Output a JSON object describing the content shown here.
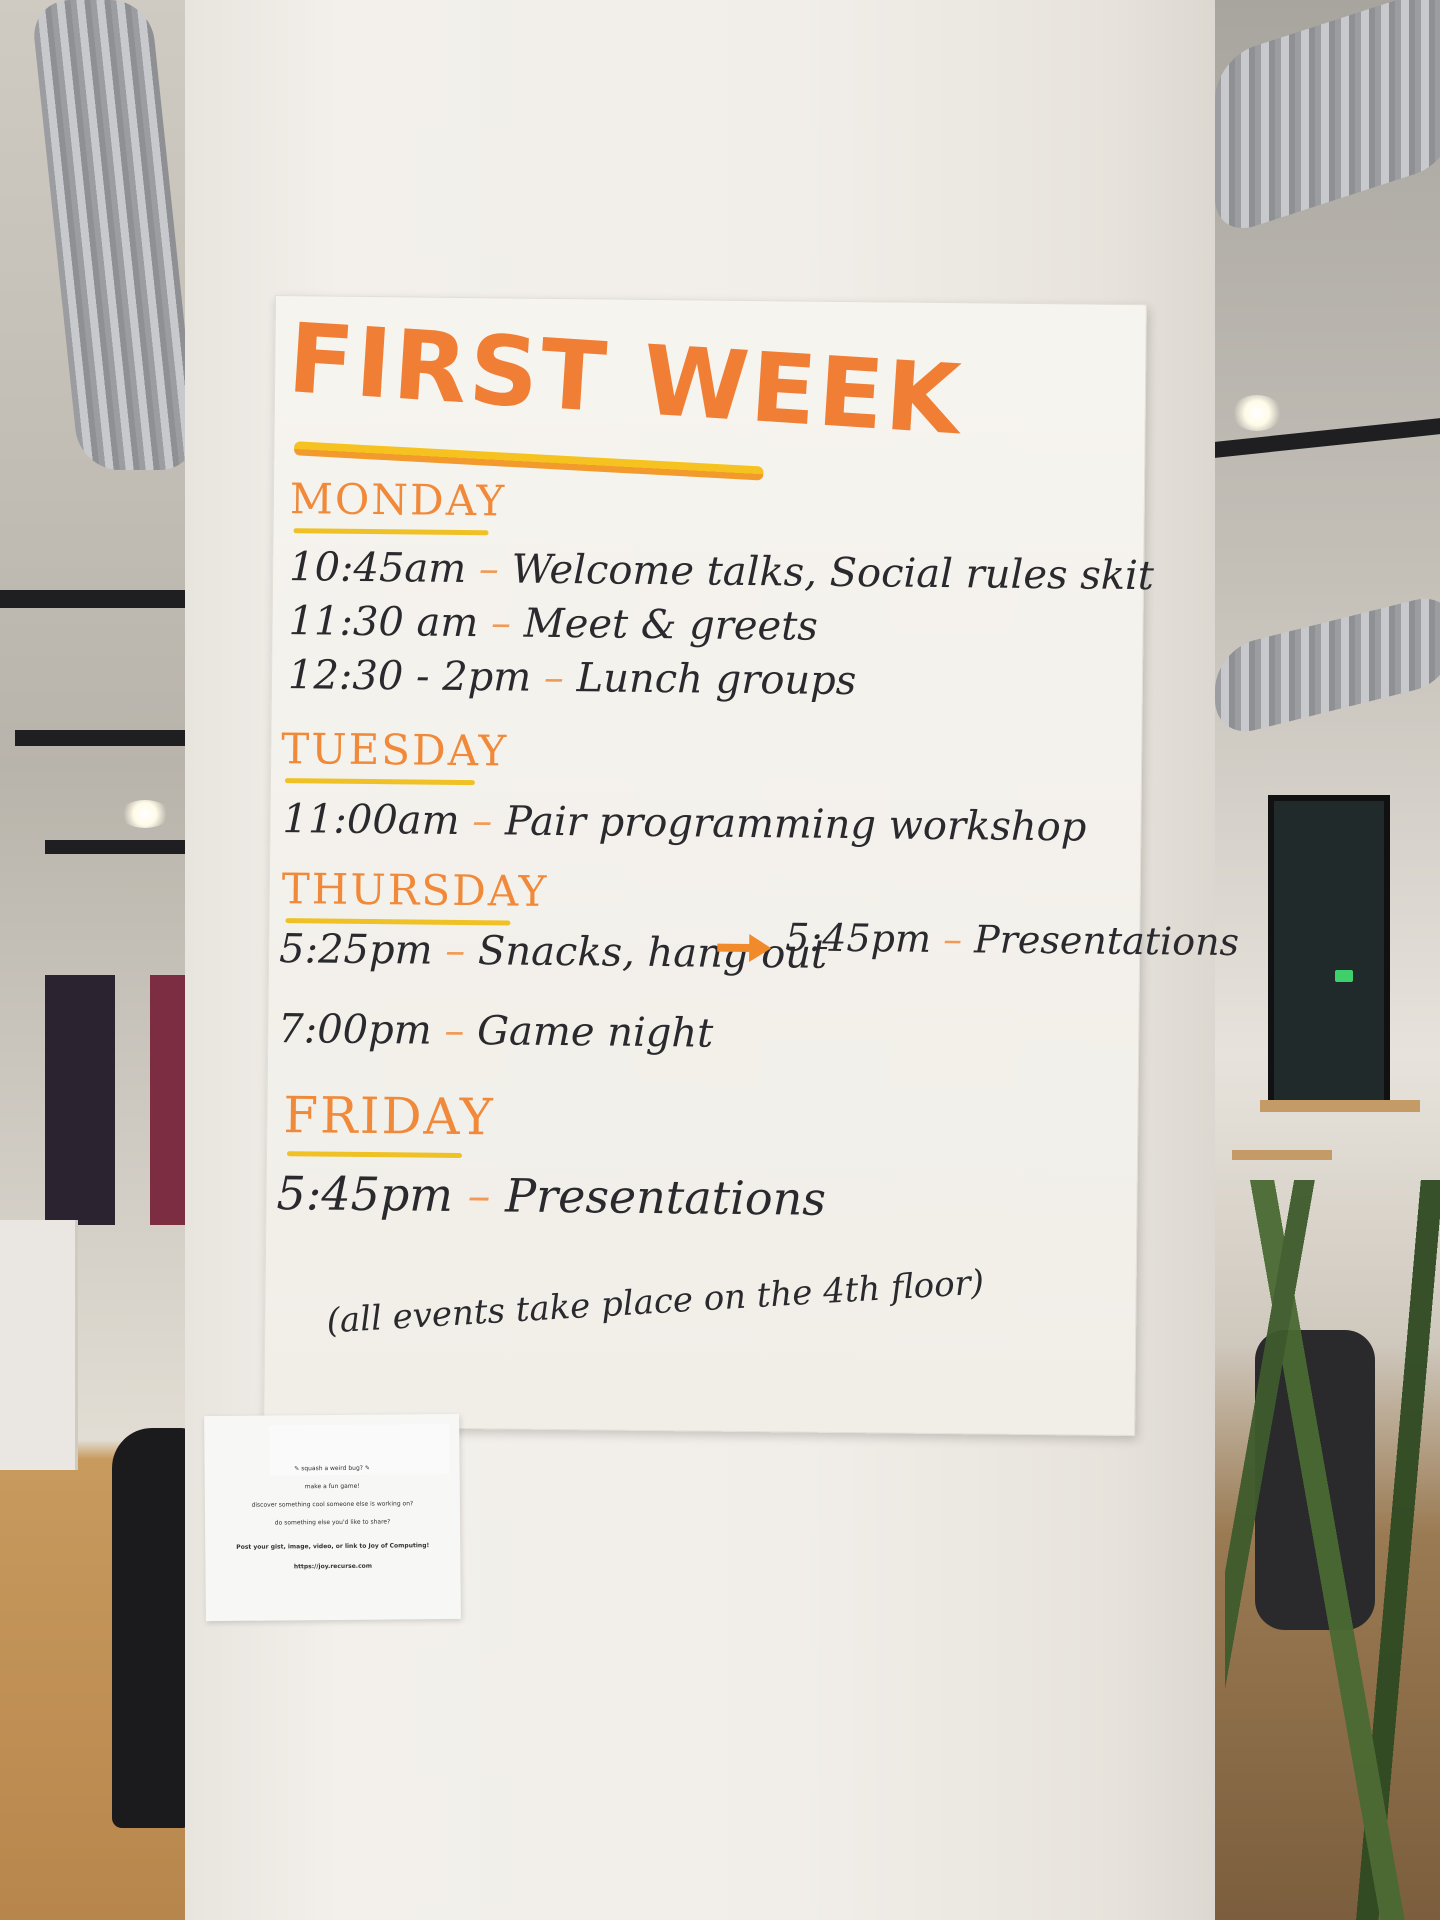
{
  "poster": {
    "title": "FIRST WEEK",
    "footer": "(all events take place on the 4th floor)",
    "days": [
      {
        "name": "MONDAY",
        "events": [
          {
            "time": "10:45am",
            "activity": "Welcome talks, Social rules skit"
          },
          {
            "time": "11:30 am",
            "activity": "Meet & greets"
          },
          {
            "time": "12:30 - 2pm",
            "activity": "Lunch groups"
          }
        ]
      },
      {
        "name": "TUESDAY",
        "events": [
          {
            "time": "11:00am",
            "activity": "Pair programming workshop"
          }
        ]
      },
      {
        "name": "THURSDAY",
        "events": [
          {
            "time": "5:25pm",
            "activity": "Snacks, hang out",
            "then_time": "5:45pm",
            "then_activity": "Presentations"
          },
          {
            "time": "7:00pm",
            "activity": "Game night"
          }
        ]
      },
      {
        "name": "FRIDAY",
        "events": [
          {
            "time": "5:45pm",
            "activity": "Presentations"
          }
        ]
      }
    ]
  },
  "note": {
    "lines": [
      "✎ squash a weird bug? ✎",
      "make a fun game!",
      "discover something cool someone else is working on?",
      "do something else you'd like to share?",
      "Post your gist, image, video, or link to Joy of Computing!",
      "https://joy.recurse.com"
    ]
  },
  "colors": {
    "title_orange": "#f07f35",
    "underline_yellow": "#f5c21f",
    "marker_black": "#2a2a2e"
  }
}
